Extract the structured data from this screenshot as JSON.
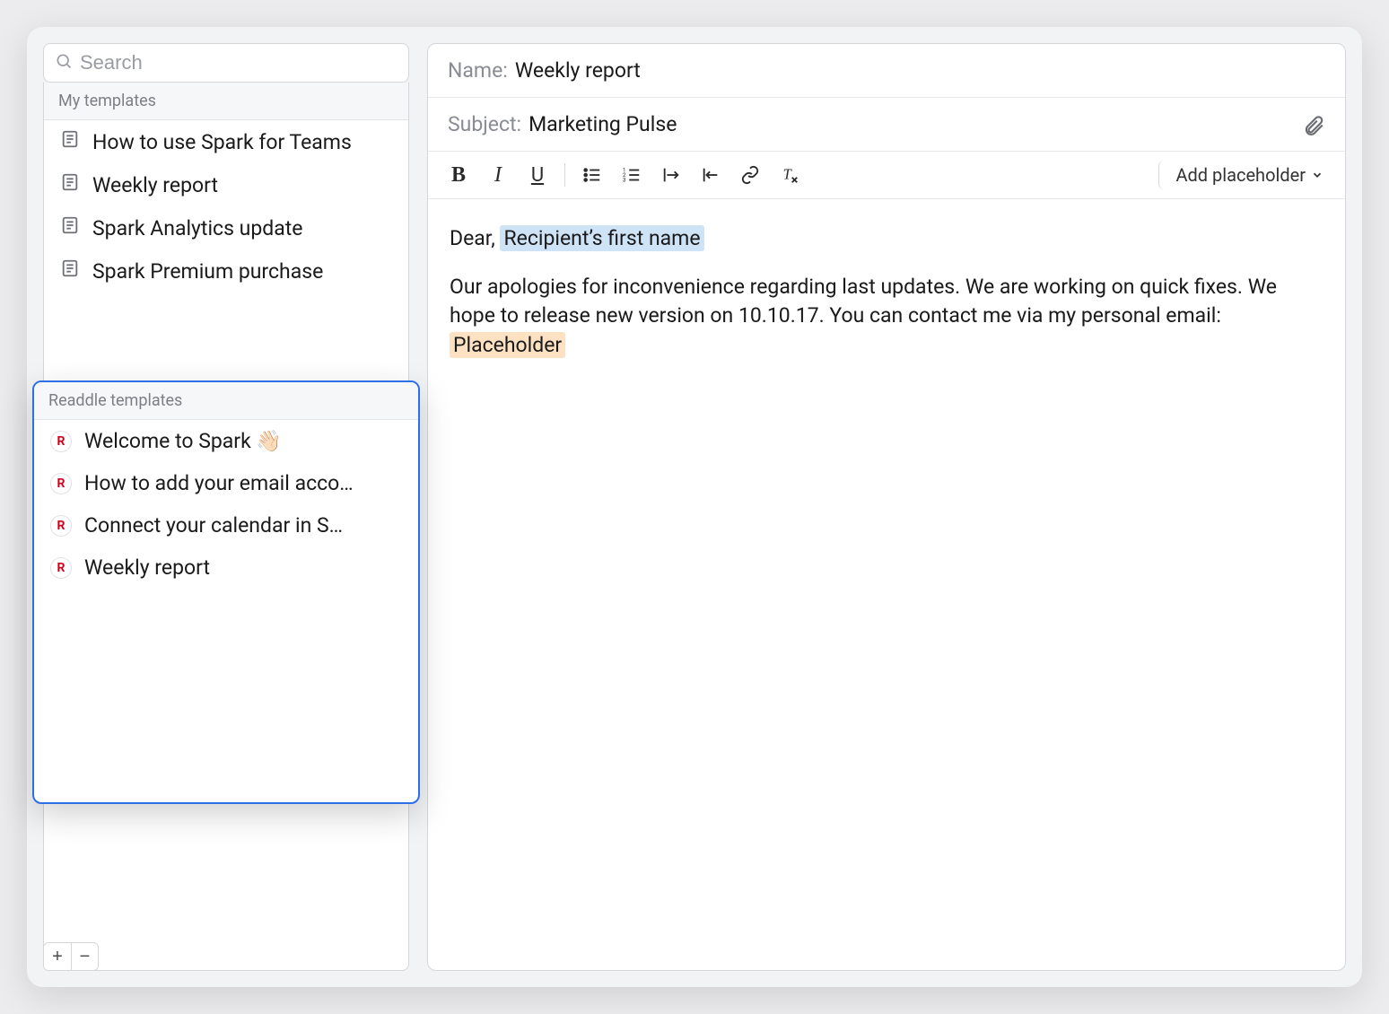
{
  "search": {
    "placeholder": "Search"
  },
  "sections": {
    "my": {
      "title": "My templates",
      "items": [
        {
          "label": "How to use Spark for Teams"
        },
        {
          "label": "Weekly report"
        },
        {
          "label": "Spark Analytics update"
        },
        {
          "label": "Spark Premium purchase"
        }
      ]
    },
    "readdle": {
      "title": "Readdle templates",
      "items": [
        {
          "label": "Welcome to Spark 👋🏻"
        },
        {
          "label": "How to add your email acco…"
        },
        {
          "label": "Connect your calendar in S…"
        },
        {
          "label": "Weekly report"
        }
      ]
    }
  },
  "editor": {
    "name_label": "Name:",
    "name_value": "Weekly report",
    "subject_label": "Subject:",
    "subject_value": "Marketing Pulse",
    "add_placeholder_label": "Add placeholder",
    "body": {
      "greeting_prefix": "Dear, ",
      "greeting_chip": "Recipient’s first name",
      "para": "Our apologies for inconvenience regarding last updates. We are working on quick fixes. We hope to release new version on 10.10.17. You can contact me via my personal email: ",
      "para_chip": "Placeholder"
    }
  },
  "buttons": {
    "plus": "+",
    "minus": "−",
    "readdle_badge": "R"
  }
}
